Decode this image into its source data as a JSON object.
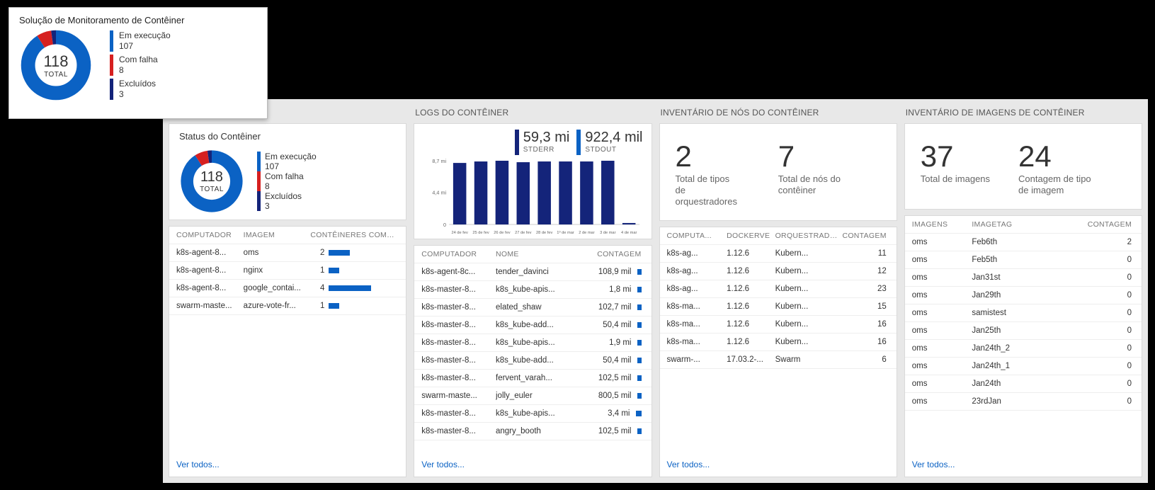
{
  "overlay": {
    "title": "Solução de Monitoramento de Contêiner",
    "total_label": "TOTAL",
    "total": "118",
    "legend": [
      {
        "label": "Em execução",
        "value": "107",
        "color": "#0b62c4"
      },
      {
        "label": "Com falha",
        "value": "8",
        "color": "#d62020"
      },
      {
        "label": "Excluídos",
        "value": "3",
        "color": "#14247a"
      }
    ]
  },
  "columns": {
    "status": {
      "sub": "Status do Contêiner",
      "donut": {
        "total": "118",
        "total_label": "TOTAL"
      },
      "legend": [
        {
          "label": "Em execução",
          "value": "107",
          "color": "#0b62c4"
        },
        {
          "label": "Com falha",
          "value": "8",
          "color": "#d62020"
        },
        {
          "label": "Excluídos",
          "value": "3",
          "color": "#14247a"
        }
      ],
      "headers": [
        "COMPUTADOR",
        "IMAGEM",
        "CONTÊINERES COM FALHA"
      ],
      "rows": [
        {
          "c1": "k8s-agent-8...",
          "c2": "oms",
          "val": "2",
          "bar": 30
        },
        {
          "c1": "k8s-agent-8...",
          "c2": "nginx",
          "val": "1",
          "bar": 15
        },
        {
          "c1": "k8s-agent-8...",
          "c2": "google_contai...",
          "val": "4",
          "bar": 60
        },
        {
          "c1": "swarm-maste...",
          "c2": "azure-vote-fr...",
          "val": "1",
          "bar": 15
        }
      ],
      "view_all": "Ver todos..."
    },
    "logs": {
      "title": "LOGS DO CONTÊINER",
      "kpi": [
        {
          "val": "59,3 mi",
          "lab": "STDERR",
          "color": "#14247a"
        },
        {
          "val": "922,4 mil",
          "lab": "STDOUT",
          "color": "#0b62c4"
        }
      ],
      "y_ticks": [
        "8,7 mi",
        "4,4 mi",
        "0"
      ],
      "x_ticks": [
        "24 de fev",
        "25 de fev",
        "26 de fev",
        "27 de fev",
        "28 de fev",
        "1º de mar",
        "2 de mar",
        "3 de mar",
        "4 de mar"
      ],
      "headers": [
        "COMPUTADOR",
        "NOME",
        "CONTAGEM"
      ],
      "rows": [
        {
          "c1": "k8s-agent-8c...",
          "c2": "tender_davinci",
          "val": "108,9 mil",
          "bar": 6
        },
        {
          "c1": "k8s-master-8...",
          "c2": "k8s_kube-apis...",
          "val": "1,8 mi",
          "bar": 6
        },
        {
          "c1": "k8s-master-8...",
          "c2": "elated_shaw",
          "val": "102,7 mil",
          "bar": 6
        },
        {
          "c1": "k8s-master-8...",
          "c2": "k8s_kube-add...",
          "val": "50,4 mil",
          "bar": 6
        },
        {
          "c1": "k8s-master-8...",
          "c2": "k8s_kube-apis...",
          "val": "1,9 mi",
          "bar": 6
        },
        {
          "c1": "k8s-master-8...",
          "c2": "k8s_kube-add...",
          "val": "50,4 mil",
          "bar": 6
        },
        {
          "c1": "k8s-master-8...",
          "c2": "fervent_varah...",
          "val": "102,5 mil",
          "bar": 6
        },
        {
          "c1": "swarm-maste...",
          "c2": "jolly_euler",
          "val": "800,5 mil",
          "bar": 6
        },
        {
          "c1": "k8s-master-8...",
          "c2": "k8s_kube-apis...",
          "val": "3,4 mi",
          "bar": 8
        },
        {
          "c1": "k8s-master-8...",
          "c2": "angry_booth",
          "val": "102,5 mil",
          "bar": 6
        }
      ],
      "view_all": "Ver todos..."
    },
    "nodes": {
      "title": "INVENTÁRIO DE NÓS DO CONTÊINER",
      "nums": [
        {
          "big": "2",
          "label": "Total de tipos\nde orquestradores"
        },
        {
          "big": "7",
          "label": "Total de nós do contêiner"
        }
      ],
      "headers": [
        "COMPUTA...",
        "DOCKERVE",
        "ORQUESTRADOR",
        "CONTAGEM"
      ],
      "rows": [
        {
          "c1": "k8s-ag...",
          "c2": "1.12.6",
          "c3": "Kubern...",
          "val": "11"
        },
        {
          "c1": "k8s-ag...",
          "c2": "1.12.6",
          "c3": "Kubern...",
          "val": "12"
        },
        {
          "c1": "k8s-ag...",
          "c2": "1.12.6",
          "c3": "Kubern...",
          "val": "23"
        },
        {
          "c1": "k8s-ma...",
          "c2": "1.12.6",
          "c3": "Kubern...",
          "val": "15"
        },
        {
          "c1": "k8s-ma...",
          "c2": "1.12.6",
          "c3": "Kubern...",
          "val": "16"
        },
        {
          "c1": "k8s-ma...",
          "c2": "1.12.6",
          "c3": "Kubern...",
          "val": "16"
        },
        {
          "c1": "swarm-...",
          "c2": "17.03.2-...",
          "c3": "Swarm",
          "val": "6"
        }
      ],
      "view_all": "Ver todos..."
    },
    "images": {
      "title": "INVENTÁRIO DE IMAGENS DE CONTÊINER",
      "nums": [
        {
          "big": "37",
          "label": "Total de imagens"
        },
        {
          "big": "24",
          "label": "Contagem de tipo\nde imagem"
        }
      ],
      "headers": [
        "IMAGENS",
        "IMAGETAG",
        "CONTAGEM"
      ],
      "rows": [
        {
          "c1": "oms",
          "c2": "Feb6th",
          "val": "2"
        },
        {
          "c1": "oms",
          "c2": "Feb5th",
          "val": "0"
        },
        {
          "c1": "oms",
          "c2": "Jan31st",
          "val": "0"
        },
        {
          "c1": "oms",
          "c2": "Jan29th",
          "val": "0"
        },
        {
          "c1": "oms",
          "c2": "samistest",
          "val": "0"
        },
        {
          "c1": "oms",
          "c2": "Jan25th",
          "val": "0"
        },
        {
          "c1": "oms",
          "c2": "Jan24th_2",
          "val": "0"
        },
        {
          "c1": "oms",
          "c2": "Jan24th_1",
          "val": "0"
        },
        {
          "c1": "oms",
          "c2": "Jan24th",
          "val": "0"
        },
        {
          "c1": "oms",
          "c2": "23rdJan",
          "val": "0"
        }
      ],
      "view_all": "Ver todos..."
    }
  },
  "chart_data": {
    "type": "bar",
    "title": "",
    "categories": [
      "24 de fev",
      "25 de fev",
      "26 de fev",
      "27 de fev",
      "28 de fev",
      "1º de mar",
      "2 de mar",
      "3 de mar",
      "4 de mar"
    ],
    "series": [
      {
        "name": "STDERR",
        "values": [
          8.4,
          8.6,
          8.7,
          8.5,
          8.6,
          8.6,
          8.6,
          8.7,
          0.2
        ],
        "unit": "mi",
        "color": "#14247a"
      }
    ],
    "ylabel": "",
    "xlabel": "",
    "ylim": [
      0,
      8.7
    ]
  }
}
